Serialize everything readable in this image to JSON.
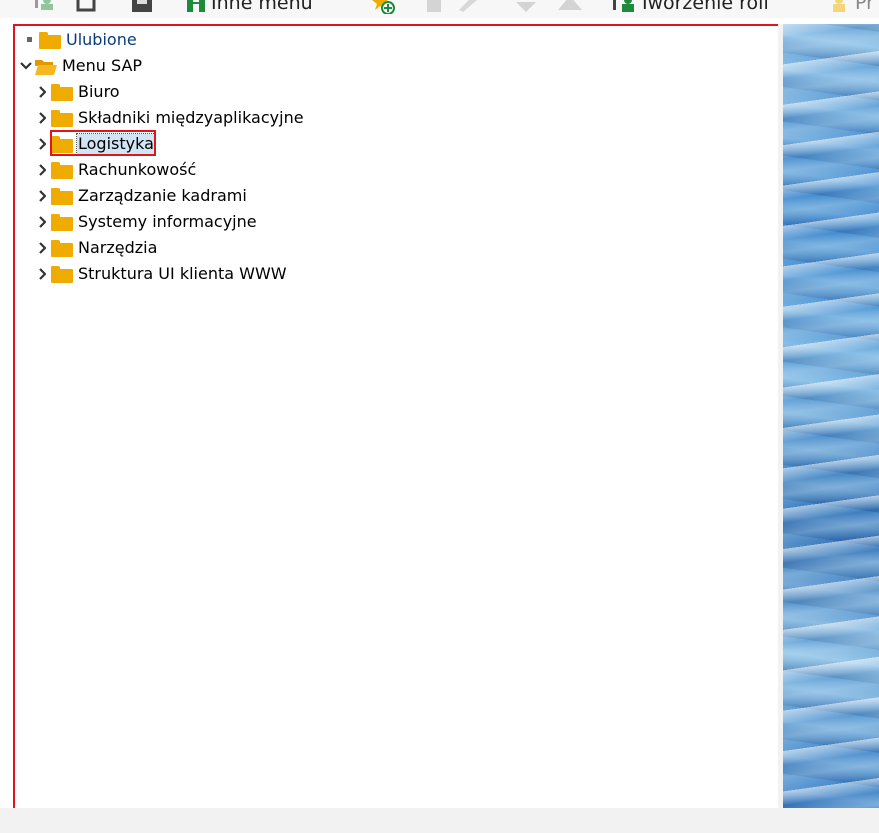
{
  "toolbar": {
    "other_menu_label": "Inne menu",
    "create_role_label": "Tworzenie roli",
    "last_label": "Pr"
  },
  "tree": {
    "favorites": "Ulubione",
    "root": "Menu SAP",
    "items": [
      {
        "label": "Biuro"
      },
      {
        "label": "Składniki międzyaplikacyjne"
      },
      {
        "label": "Logistyka"
      },
      {
        "label": "Rachunkowość"
      },
      {
        "label": "Zarządzanie kadrami"
      },
      {
        "label": "Systemy informacyjne"
      },
      {
        "label": "Narzędzia"
      },
      {
        "label": "Struktura UI klienta WWW"
      }
    ],
    "selected_item": "Logistyka"
  },
  "colors": {
    "folder": "#f0ab00",
    "highlight_border": "#e2151f",
    "selection_bg": "#d1e6f5",
    "favorites_text": "#0a3c78",
    "toolbar_icon_green": "#1e8a3c"
  }
}
